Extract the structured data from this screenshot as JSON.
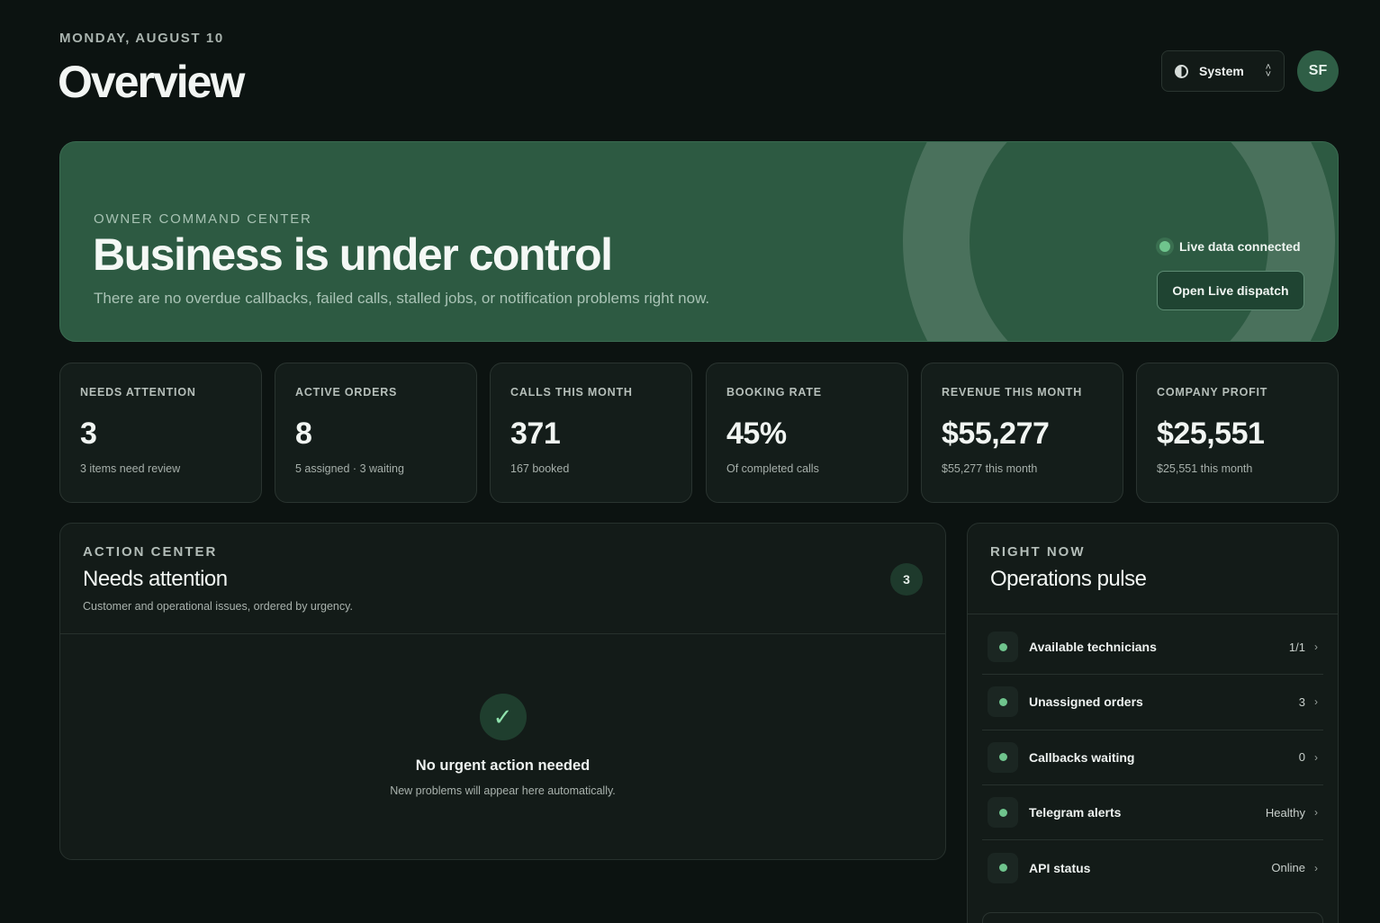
{
  "header": {
    "date": "MONDAY, AUGUST 10",
    "title": "Overview",
    "theme_label": "System",
    "avatar_initials": "SF"
  },
  "hero": {
    "eyebrow": "OWNER COMMAND CENTER",
    "title": "Business is under control",
    "subtitle": "There are no overdue callbacks, failed calls, stalled jobs, or notification problems right now.",
    "live_status": "Live data connected",
    "dispatch_button": "Open Live dispatch"
  },
  "stats": [
    {
      "label": "NEEDS ATTENTION",
      "value": "3",
      "sub": "3 items need review"
    },
    {
      "label": "ACTIVE ORDERS",
      "value": "8",
      "sub": "5 assigned · 3 waiting"
    },
    {
      "label": "CALLS THIS MONTH",
      "value": "371",
      "sub": "167 booked"
    },
    {
      "label": "BOOKING RATE",
      "value": "45%",
      "sub": "Of completed calls"
    },
    {
      "label": "REVENUE THIS MONTH",
      "value": "$55,277",
      "sub": "$55,277 this month"
    },
    {
      "label": "COMPANY PROFIT",
      "value": "$25,551",
      "sub": "$25,551 this month"
    }
  ],
  "action_center": {
    "eyebrow": "ACTION CENTER",
    "title": "Needs attention",
    "description": "Customer and operational issues, ordered by urgency.",
    "count": "3",
    "empty_title": "No urgent action needed",
    "empty_sub": "New problems will appear here automatically."
  },
  "pulse": {
    "eyebrow": "RIGHT NOW",
    "title": "Operations pulse",
    "items": [
      {
        "label": "Available technicians",
        "value": "1/1"
      },
      {
        "label": "Unassigned orders",
        "value": "3"
      },
      {
        "label": "Callbacks waiting",
        "value": "0"
      },
      {
        "label": "Telegram alerts",
        "value": "Healthy"
      },
      {
        "label": "API status",
        "value": "Online"
      }
    ]
  },
  "colors": {
    "background": "#0c1311",
    "hero": "#2d5a42",
    "accent_green": "#6fc48d"
  },
  "icons": [
    "theme-contrast-icon",
    "updown-icon",
    "live-dot-icon",
    "check-icon",
    "status-dot-icon",
    "chevron-right-icon"
  ]
}
